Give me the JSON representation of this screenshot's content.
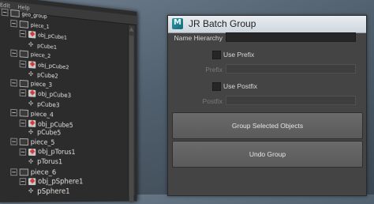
{
  "outliner": {
    "menu": [
      "Edit",
      "Help"
    ],
    "rows": [
      {
        "label": "geo_group",
        "type": "group",
        "depth": 0
      },
      {
        "label": "piece_1",
        "type": "group",
        "depth": 1
      },
      {
        "label": "obj_pCube1",
        "type": "transform",
        "depth": 2
      },
      {
        "label": "pCube1",
        "type": "shape",
        "depth": 3
      },
      {
        "label": "piece_2",
        "type": "group",
        "depth": 1
      },
      {
        "label": "obj_pCube2",
        "type": "transform",
        "depth": 2
      },
      {
        "label": "pCube2",
        "type": "shape",
        "depth": 3
      },
      {
        "label": "piece_3",
        "type": "group",
        "depth": 1
      },
      {
        "label": "obj_pCube3",
        "type": "transform",
        "depth": 2
      },
      {
        "label": "pCube3",
        "type": "shape",
        "depth": 3
      },
      {
        "label": "piece_4",
        "type": "group",
        "depth": 1
      },
      {
        "label": "obj_pCube5",
        "type": "transform",
        "depth": 2
      },
      {
        "label": "pCube5",
        "type": "shape",
        "depth": 3
      },
      {
        "label": "piece_5",
        "type": "group",
        "depth": 1
      },
      {
        "label": "obj_pTorus1",
        "type": "transform",
        "depth": 2
      },
      {
        "label": "pTorus1",
        "type": "shape",
        "depth": 3
      },
      {
        "label": "piece_6",
        "type": "group",
        "depth": 1
      },
      {
        "label": "obj_pSphere1",
        "type": "transform",
        "depth": 2
      },
      {
        "label": "pSphere1",
        "type": "shape",
        "depth": 3
      }
    ]
  },
  "dialog": {
    "title": "JR Batch Group",
    "name_hierarchy": {
      "label": "Name Hierarchy",
      "value": ""
    },
    "use_prefix": {
      "label": "Use Prefix",
      "checked": false
    },
    "prefix": {
      "label": "Prefix",
      "value": ""
    },
    "use_postfix": {
      "label": "Use Postfix",
      "checked": false
    },
    "postfix": {
      "label": "Postfix",
      "value": ""
    },
    "group_button": "Group Selected Objects",
    "undo_button": "Undo Group"
  },
  "colors": {
    "background": "#5d6c7b",
    "outliner_bg": "#2c2c2c",
    "dialog_bg": "#444444",
    "button_bg": "#626262",
    "transform_icon_accent": "#d23b3b"
  }
}
